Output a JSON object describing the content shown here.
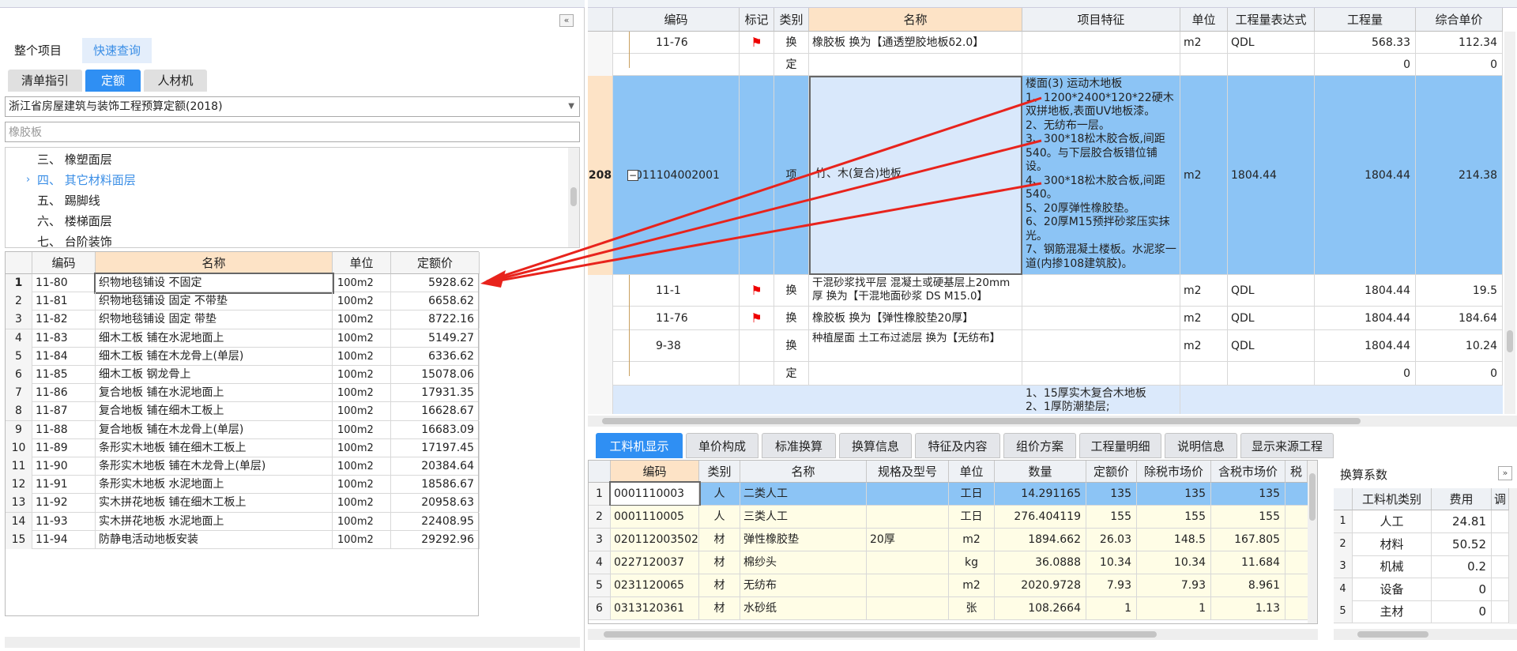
{
  "left": {
    "scope_tabs": [
      "整个项目",
      "快速查询"
    ],
    "sub_tabs": [
      "清单指引",
      "定额",
      "人材机"
    ],
    "quota_library": "浙江省房屋建筑与装饰工程预算定额(2018)",
    "search_value": "橡胶板",
    "tree": [
      {
        "label": "三、 橡塑面层"
      },
      {
        "label": "四、 其它材料面层",
        "expand": "›"
      },
      {
        "label": "五、 踢脚线"
      },
      {
        "label": "六、 楼梯面层"
      },
      {
        "label": "七、 台阶装饰"
      }
    ],
    "columns": [
      "编码",
      "名称",
      "单位",
      "定额价"
    ],
    "rows": [
      {
        "n": "1",
        "code": "11-80",
        "name": "织物地毯铺设 不固定",
        "unit": "100m2",
        "price": "5928.62"
      },
      {
        "n": "2",
        "code": "11-81",
        "name": "织物地毯铺设 固定 不带垫",
        "unit": "100m2",
        "price": "6658.62"
      },
      {
        "n": "3",
        "code": "11-82",
        "name": "织物地毯铺设 固定 带垫",
        "unit": "100m2",
        "price": "8722.16"
      },
      {
        "n": "4",
        "code": "11-83",
        "name": "细木工板 铺在水泥地面上",
        "unit": "100m2",
        "price": "5149.27"
      },
      {
        "n": "5",
        "code": "11-84",
        "name": "细木工板 铺在木龙骨上(单层)",
        "unit": "100m2",
        "price": "6336.62"
      },
      {
        "n": "6",
        "code": "11-85",
        "name": "细木工板 钢龙骨上",
        "unit": "100m2",
        "price": "15078.06"
      },
      {
        "n": "7",
        "code": "11-86",
        "name": "复合地板 铺在水泥地面上",
        "unit": "100m2",
        "price": "17931.35"
      },
      {
        "n": "8",
        "code": "11-87",
        "name": "复合地板 铺在细木工板上",
        "unit": "100m2",
        "price": "16628.67"
      },
      {
        "n": "9",
        "code": "11-88",
        "name": "复合地板 铺在木龙骨上(单层)",
        "unit": "100m2",
        "price": "16683.09"
      },
      {
        "n": "10",
        "code": "11-89",
        "name": "条形实木地板 铺在细木工板上",
        "unit": "100m2",
        "price": "17197.45"
      },
      {
        "n": "11",
        "code": "11-90",
        "name": "条形实木地板 铺在木龙骨上(单层)",
        "unit": "100m2",
        "price": "20384.64"
      },
      {
        "n": "12",
        "code": "11-91",
        "name": "条形实木地板 水泥地面上",
        "unit": "100m2",
        "price": "18586.67"
      },
      {
        "n": "13",
        "code": "11-92",
        "name": "实木拼花地板 铺在细木工板上",
        "unit": "100m2",
        "price": "20958.63"
      },
      {
        "n": "14",
        "code": "11-93",
        "name": "实木拼花地板 水泥地面上",
        "unit": "100m2",
        "price": "22408.95"
      },
      {
        "n": "15",
        "code": "11-94",
        "name": "防静电活动地板安装",
        "unit": "100m2",
        "price": "29292.96"
      }
    ]
  },
  "right": {
    "columns": [
      "编码",
      "标记",
      "类别",
      "名称",
      "项目特征",
      "单位",
      "工程量表达式",
      "工程量",
      "综合单价"
    ],
    "row_a": {
      "code": "11-76",
      "type": "换",
      "name": "橡胶板  换为【通透塑胶地板δ2.0】",
      "unit": "m2",
      "expr": "QDL",
      "qty": "568.33",
      "price": "112.34"
    },
    "row_b": {
      "type": "定",
      "qty": "0",
      "price": "0"
    },
    "row_main": {
      "seq": "208",
      "code": "011104002001",
      "type": "项",
      "name": "竹、木(复合)地板",
      "feature": "楼面(3) 运动木地板\n1、1200*2400*120*22硬木双拼地板,表面UV地板漆。\n2、无纺布一层。\n3、300*18松木胶合板,间距540。与下层胶合板错位铺设。\n4、300*18松木胶合板,间距540。\n5、20厚弹性橡胶垫。\n6、20厚M15预拌砂浆压实抹光。\n7、钢筋混凝土楼板。水泥浆一道(内掺108建筑胶)。",
      "unit": "m2",
      "expr": "1804.44",
      "qty": "1804.44",
      "price": "214.38"
    },
    "row_c": {
      "code": "11-1",
      "type": "换",
      "name": "干混砂浆找平层 混凝土或硬基层上20mm厚  换为【干混地面砂浆 DS M15.0】",
      "unit": "m2",
      "expr": "QDL",
      "qty": "1804.44",
      "price": "19.5"
    },
    "row_d": {
      "code": "11-76",
      "type": "换",
      "name": "橡胶板  换为【弹性橡胶垫20厚】",
      "unit": "m2",
      "expr": "QDL",
      "qty": "1804.44",
      "price": "184.64"
    },
    "row_e": {
      "code": "9-38",
      "type": "换",
      "name": "种植屋面 土工布过滤层  换为【无纺布】",
      "unit": "m2",
      "expr": "QDL",
      "qty": "1804.44",
      "price": "10.24"
    },
    "row_f": {
      "type": "定",
      "qty": "0",
      "price": "0"
    },
    "row_g": {
      "feature": "1、15厚实木复合木地板\n2、1厚防潮垫层;"
    }
  },
  "bottom": {
    "tabs": [
      "工料机显示",
      "单价构成",
      "标准换算",
      "换算信息",
      "特征及内容",
      "组价方案",
      "工程量明细",
      "说明信息",
      "显示来源工程"
    ],
    "columns": [
      "编码",
      "类别",
      "名称",
      "规格及型号",
      "单位",
      "数量",
      "定额价",
      "除税市场价",
      "含税市场价",
      "税率"
    ],
    "rows": [
      {
        "n": "1",
        "code": "0001110003",
        "cat": "人",
        "name": "二类人工",
        "spec": "",
        "unit": "工日",
        "qty": "14.291165",
        "quota": "135",
        "ex_tax": "135",
        "in_tax": "135"
      },
      {
        "n": "2",
        "code": "0001110005",
        "cat": "人",
        "name": "三类人工",
        "spec": "",
        "unit": "工日",
        "qty": "276.404119",
        "quota": "155",
        "ex_tax": "155",
        "in_tax": "155"
      },
      {
        "n": "3",
        "code": "020112003502",
        "cat": "材",
        "name": "弹性橡胶垫",
        "spec": "20厚",
        "unit": "m2",
        "qty": "1894.662",
        "quota": "26.03",
        "ex_tax": "148.5",
        "in_tax": "167.805"
      },
      {
        "n": "4",
        "code": "0227120037",
        "cat": "材",
        "name": "棉纱头",
        "spec": "",
        "unit": "kg",
        "qty": "36.0888",
        "quota": "10.34",
        "ex_tax": "10.34",
        "in_tax": "11.684"
      },
      {
        "n": "5",
        "code": "0231120065",
        "cat": "材",
        "name": "无纺布",
        "spec": "",
        "unit": "m2",
        "qty": "2020.9728",
        "quota": "7.93",
        "ex_tax": "7.93",
        "in_tax": "8.961"
      },
      {
        "n": "6",
        "code": "0313120361",
        "cat": "材",
        "name": "水砂纸",
        "spec": "",
        "unit": "张",
        "qty": "108.2664",
        "quota": "1",
        "ex_tax": "1",
        "in_tax": "1.13"
      }
    ],
    "coef": {
      "title": "换算系数",
      "columns": [
        "工料机类别",
        "费用",
        "调"
      ],
      "rows": [
        {
          "n": "1",
          "cat": "人工",
          "val": "24.81"
        },
        {
          "n": "2",
          "cat": "材料",
          "val": "50.52"
        },
        {
          "n": "3",
          "cat": "机械",
          "val": "0.2"
        },
        {
          "n": "4",
          "cat": "设备",
          "val": "0"
        },
        {
          "n": "5",
          "cat": "主材",
          "val": "0"
        }
      ]
    }
  }
}
